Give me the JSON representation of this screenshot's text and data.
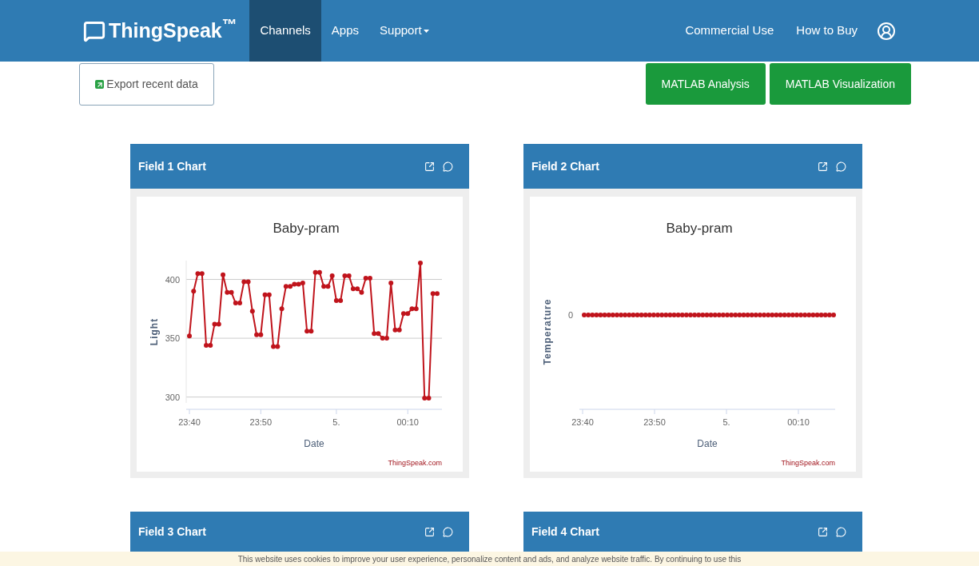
{
  "header": {
    "logo": "ThingSpeak$^{™}$",
    "nav": [
      {
        "label": "Channels",
        "selected": true,
        "dropdown": false
      },
      {
        "label": "Apps",
        "selected": false,
        "dropdown": false
      },
      {
        "label": "Support",
        "selected": false,
        "dropdown": true
      }
    ],
    "right_links": [
      "Commercial Use",
      "How to Buy"
    ]
  },
  "toolbar": {
    "export_button": "Export recent data",
    "buttons": [
      "MATLAB Analysis",
      "MATLAB Visualization"
    ]
  },
  "panels": [
    {
      "title": "Field 1 Chart",
      "credit": "ThingSpeak.com",
      "chart_data": {
        "type": "line",
        "title": "Baby-pram",
        "xlabel": "Date",
        "ylabel": "Light",
        "categories": [
          "23:40",
          null,
          null,
          null,
          null,
          null,
          null,
          null,
          null,
          null,
          null,
          null,
          null,
          null,
          null,
          null,
          null,
          "23:50",
          null,
          null,
          null,
          null,
          null,
          null,
          null,
          null,
          null,
          null,
          null,
          null,
          null,
          null,
          null,
          null,
          null,
          "5.",
          null,
          null,
          null,
          null,
          null,
          null,
          null,
          null,
          null,
          null,
          null,
          null,
          null,
          null,
          null,
          null,
          "00:10",
          null,
          null,
          null,
          null,
          null,
          null,
          null
        ],
        "series": [
          {
            "color": "#c0141c",
            "values": [
              352,
              390,
              405,
              405,
              344,
              344,
              362,
              362,
              404,
              389,
              389,
              380,
              380,
              398,
              398,
              373,
              353,
              353,
              387,
              387,
              343,
              343,
              375,
              394,
              394,
              396,
              396,
              397,
              356,
              356,
              406,
              406,
              394,
              394,
              403,
              382,
              382,
              403,
              403,
              392,
              392,
              389,
              401,
              401,
              354,
              354,
              350,
              350,
              397,
              357,
              357,
              371,
              371,
              375,
              375,
              414,
              299,
              299,
              388,
              388
            ]
          }
        ],
        "ylim": [
          295,
          416
        ],
        "yticks": [
          300,
          350,
          400
        ],
        "grid": true,
        "marker": true
      }
    },
    {
      "title": "Field 2 Chart",
      "credit": "ThingSpeak.com",
      "chart_picture": {
        "title": "Baby-pram",
        "xlabel": "Date",
        "ylabel": "Temperature",
        "xtick_labels": [
          "23:40",
          "23:50",
          "5.",
          "00:10"
        ],
        "ytick_label": "0"
      }
    },
    {
      "title": "Field 3 Chart"
    },
    {
      "title": "Field 4 Chart"
    }
  ],
  "cookie_banner": {
    "text": "This website uses cookies to improve your user experience, personalize content and ads, and analyze website traffic. By continuing to use this"
  }
}
